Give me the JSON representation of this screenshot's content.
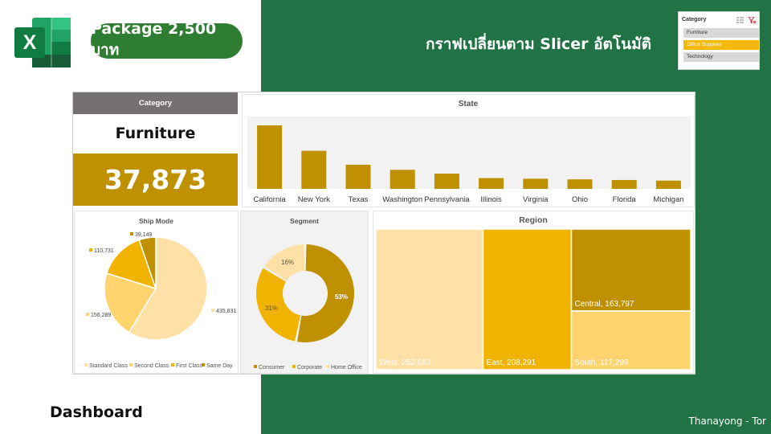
{
  "header": {
    "package_label": "Package 2,500 บาท",
    "headline": "กราฟเปลี่ยนตาม Slicer อัตโนมัติ"
  },
  "slicer": {
    "title": "Category",
    "items": [
      {
        "label": "Furniture",
        "active": false
      },
      {
        "label": "Office Supplies",
        "active": true
      },
      {
        "label": "Technology",
        "active": false
      }
    ]
  },
  "category_card": {
    "header": "Category",
    "name": "Furniture",
    "value": "37,873"
  },
  "colors": {
    "green": "#217346",
    "gold_dark": "#bf9000",
    "gold": "#f0b400",
    "gold_light": "#ffd36e",
    "cream": "#ffe0a6"
  },
  "chart_data": [
    {
      "type": "bar",
      "title": "State",
      "categories": [
        "California",
        "New York",
        "Texas",
        "Washington",
        "Pennsylvania",
        "Illinois",
        "Virginia",
        "Ohio",
        "Florida",
        "Michigan"
      ],
      "values": [
        100,
        60,
        38,
        30,
        24,
        17,
        16,
        15,
        14,
        13
      ]
    },
    {
      "type": "pie",
      "title": "Ship Mode",
      "labels": [
        "Standard Class",
        "Second Class",
        "First Class",
        "Same Day"
      ],
      "values": [
        435831,
        156289,
        110731,
        39149
      ],
      "data_labels": [
        "435,831",
        "156,289",
        "110,731",
        "39,149"
      ],
      "legend": "bottom"
    },
    {
      "type": "pie",
      "title": "Segment",
      "labels": [
        "Consumer",
        "Corporate",
        "Home Office"
      ],
      "values": [
        53,
        31,
        16
      ],
      "data_labels": [
        "53%",
        "31%",
        "16%"
      ],
      "legend": "bottom"
    },
    {
      "type": "treemap",
      "title": "Region",
      "labels": [
        "West",
        "East",
        "Central",
        "South"
      ],
      "values": [
        252613,
        208291,
        163797,
        117299
      ],
      "data_labels": [
        "West, 252,613",
        "East, 208,291",
        "Central, 163,797",
        "South, 117,299"
      ]
    }
  ],
  "footer": {
    "dashboard_label": "Dashboard",
    "credit": "Thanayong - Tor"
  }
}
